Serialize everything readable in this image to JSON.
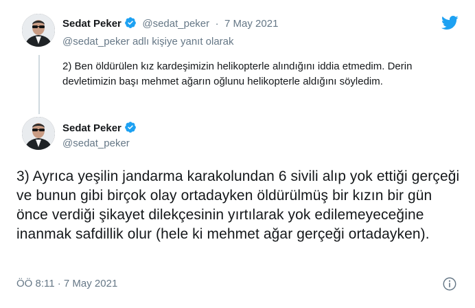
{
  "reply_tweet": {
    "author_name": "Sedat Peker",
    "author_handle": "@sedat_peker",
    "separator": "·",
    "date": "7 May 2021",
    "reply_context": "@sedat_peker adlı kişiye yanıt olarak",
    "text": "2) Ben öldürülen kız kardeşimizin helikopterle alındığını iddia etmedim. Derin devletimizin başı mehmet ağarın oğlunu helikopterle aldığını söyledim."
  },
  "main_tweet": {
    "author_name": "Sedat Peker",
    "author_handle": "@sedat_peker",
    "text": "3) Ayrıca yeşilin jandarma karakolundan 6 sivili alıp yok ettiği gerçeği ve bunun gibi birçok olay ortadayken öldürülmüş bir kızın bir gün önce verdiği şikayet dilekçesinin yırtılarak yok edilemeyeceğine inanmak safdillik olur (hele ki mehmet ağar gerçeği ortadayken).",
    "timestamp": "ÖÖ 8:11 · 7 May 2021"
  },
  "icons": {
    "brand": "twitter-bird-icon",
    "verified": "verified-badge-icon",
    "info": "info-icon"
  },
  "colors": {
    "brand_blue": "#1da1f2",
    "secondary_text": "#657786",
    "primary_text": "#14171a",
    "thread_line": "#cfd9de"
  }
}
